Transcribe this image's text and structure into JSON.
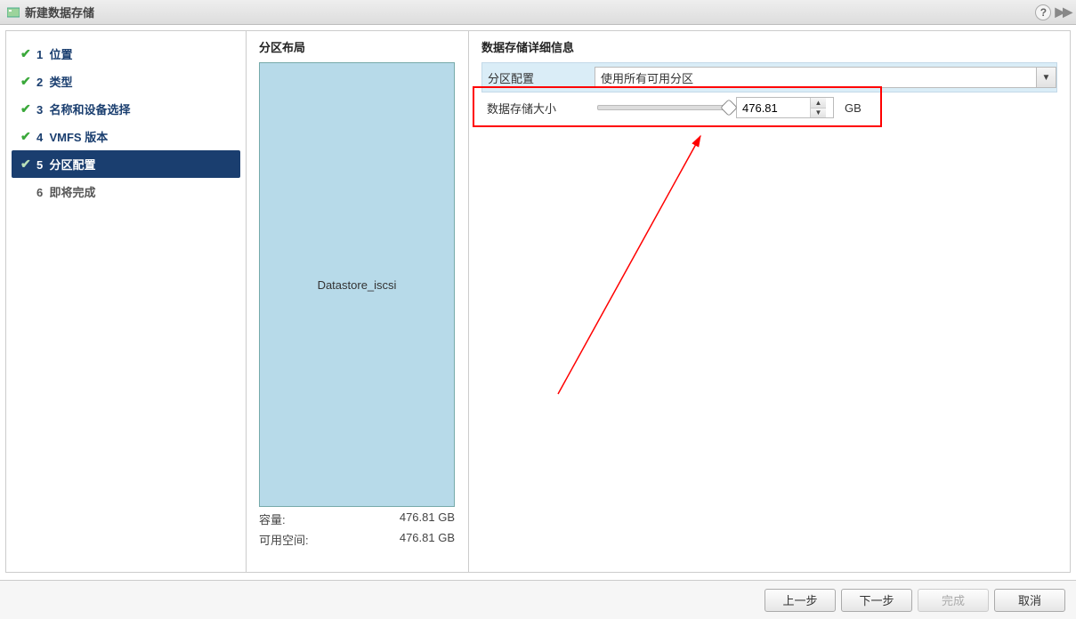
{
  "title": "新建数据存储",
  "steps": [
    {
      "num": "1",
      "label": "位置",
      "done": true
    },
    {
      "num": "2",
      "label": "类型",
      "done": true
    },
    {
      "num": "3",
      "label": "名称和设备选择",
      "done": true
    },
    {
      "num": "4",
      "label": "VMFS 版本",
      "done": true
    },
    {
      "num": "5",
      "label": "分区配置",
      "done": true,
      "selected": true
    },
    {
      "num": "6",
      "label": "即将完成",
      "done": false
    }
  ],
  "partition": {
    "title": "分区布局",
    "name": "Datastore_iscsi",
    "capacity_label": "容量:",
    "capacity_value": "476.81 GB",
    "free_label": "可用空间:",
    "free_value": "476.81 GB"
  },
  "detail": {
    "title": "数据存储详细信息",
    "config_label": "分区配置",
    "config_value": "使用所有可用分区",
    "size_label": "数据存储大小",
    "size_value": "476.81",
    "size_unit": "GB"
  },
  "buttons": {
    "prev": "上一步",
    "next": "下一步",
    "finish": "完成",
    "cancel": "取消"
  }
}
